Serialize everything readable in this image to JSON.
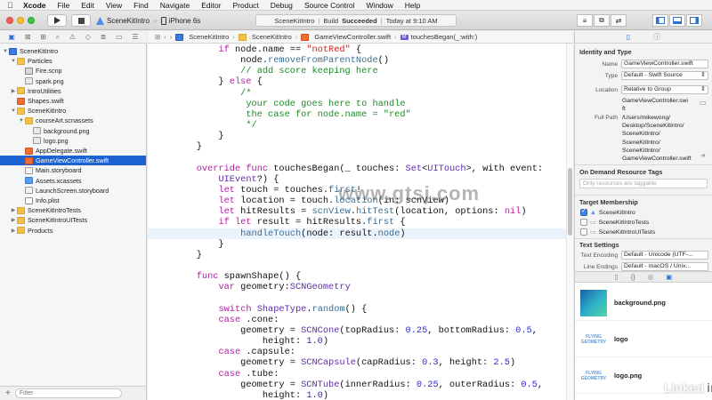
{
  "menubar": {
    "items": [
      "Xcode",
      "File",
      "Edit",
      "View",
      "Find",
      "Navigate",
      "Editor",
      "Product",
      "Debug",
      "Source Control",
      "Window",
      "Help"
    ]
  },
  "toolbar": {
    "scheme": "SceneKitIntro",
    "device": "iPhone 6s",
    "status_project": "SceneKitIntro",
    "status_build": "Build",
    "status_result": "Succeeded",
    "status_time": "Today at 9:10 AM"
  },
  "navigator": {
    "rows": [
      {
        "label": "SceneKitIntro",
        "icon": "project-icon",
        "indent": 0,
        "open": true
      },
      {
        "label": "Particles",
        "icon": "folder-icon",
        "indent": 1,
        "open": true
      },
      {
        "label": "Fire.scnp",
        "icon": "particle-file-icon",
        "indent": 2,
        "open": null
      },
      {
        "label": "spark.png",
        "icon": "image-file-icon",
        "indent": 2,
        "open": null
      },
      {
        "label": "IntroUtilities",
        "icon": "folder-icon",
        "indent": 1,
        "open": false
      },
      {
        "label": "Shapes.swift",
        "icon": "swift-file-icon",
        "indent": 1,
        "open": null
      },
      {
        "label": "SceneKitIntro",
        "icon": "folder-icon",
        "indent": 1,
        "open": true
      },
      {
        "label": "courseArt.scnassets",
        "icon": "folder-icon",
        "indent": 2,
        "open": true
      },
      {
        "label": "background.png",
        "icon": "image-file-icon",
        "indent": 3,
        "open": null
      },
      {
        "label": "logo.png",
        "icon": "image-file-icon",
        "indent": 3,
        "open": null
      },
      {
        "label": "AppDelegate.swift",
        "icon": "swift-file-icon",
        "indent": 2,
        "open": null
      },
      {
        "label": "GameViewController.swift",
        "icon": "swift-file-icon",
        "indent": 2,
        "open": null,
        "selected": true
      },
      {
        "label": "Main.storyboard",
        "icon": "storyboard-file-icon",
        "indent": 2,
        "open": null
      },
      {
        "label": "Assets.xcassets",
        "icon": "asset-catalog-icon",
        "indent": 2,
        "open": null
      },
      {
        "label": "LaunchScreen.storyboard",
        "icon": "storyboard-file-icon",
        "indent": 2,
        "open": null
      },
      {
        "label": "Info.plist",
        "icon": "plist-file-icon",
        "indent": 2,
        "open": null
      },
      {
        "label": "SceneKitIntroTests",
        "icon": "folder-icon",
        "indent": 1,
        "open": false
      },
      {
        "label": "SceneKitIntroUITests",
        "icon": "folder-icon",
        "indent": 1,
        "open": false
      },
      {
        "label": "Products",
        "icon": "folder-icon",
        "indent": 1,
        "open": false
      }
    ],
    "filter_placeholder": "Filter"
  },
  "jumpbar": {
    "crumbs": [
      "SceneKitIntro",
      "SceneKitIntro",
      "GameViewController.swift",
      "touchesBegan(_:with:)"
    ]
  },
  "editor": {
    "lines": [
      [
        {
          "t": "        "
        },
        {
          "t": "if",
          "c": "kw"
        },
        {
          "t": " node.name == "
        },
        {
          "t": "\"notRed\"",
          "c": "st"
        },
        {
          "t": " {"
        }
      ],
      [
        {
          "t": "            node."
        },
        {
          "t": "removeFromParentNode",
          "c": "fn"
        },
        {
          "t": "()"
        }
      ],
      [
        {
          "t": "            "
        },
        {
          "t": "// add score keeping here",
          "c": "cm"
        }
      ],
      [
        {
          "t": "        } "
        },
        {
          "t": "else",
          "c": "kw"
        },
        {
          "t": " {"
        }
      ],
      [
        {
          "t": "            "
        },
        {
          "t": "/*",
          "c": "cm"
        }
      ],
      [
        {
          "t": "             your code goes here to handle",
          "c": "cm"
        }
      ],
      [
        {
          "t": "             the case for node.name = \"red\"",
          "c": "cm"
        }
      ],
      [
        {
          "t": "             */",
          "c": "cm"
        }
      ],
      [
        {
          "t": "        }"
        }
      ],
      [
        {
          "t": "    }"
        }
      ],
      [
        {
          "t": ""
        }
      ],
      [
        {
          "t": "    "
        },
        {
          "t": "override",
          "c": "kw"
        },
        {
          "t": " "
        },
        {
          "t": "func",
          "c": "kw"
        },
        {
          "t": " touchesBegan(_ touches: "
        },
        {
          "t": "Set",
          "c": "ty"
        },
        {
          "t": "<"
        },
        {
          "t": "UITouch",
          "c": "ty"
        },
        {
          "t": ">, with event:"
        }
      ],
      [
        {
          "t": "        "
        },
        {
          "t": "UIEvent",
          "c": "ty"
        },
        {
          "t": "?) {"
        }
      ],
      [
        {
          "t": "        "
        },
        {
          "t": "let",
          "c": "kw"
        },
        {
          "t": " touch = touches."
        },
        {
          "t": "first",
          "c": "fn"
        },
        {
          "t": "!"
        }
      ],
      [
        {
          "t": "        "
        },
        {
          "t": "let",
          "c": "kw"
        },
        {
          "t": " location = touch."
        },
        {
          "t": "location",
          "c": "fn"
        },
        {
          "t": "(in: scnView)"
        }
      ],
      [
        {
          "t": "        "
        },
        {
          "t": "let",
          "c": "kw"
        },
        {
          "t": " hitResults = "
        },
        {
          "t": "scnView",
          "c": "fn"
        },
        {
          "t": "."
        },
        {
          "t": "hitTest",
          "c": "fn"
        },
        {
          "t": "(location, options: "
        },
        {
          "t": "nil",
          "c": "kw"
        },
        {
          "t": ")"
        }
      ],
      [
        {
          "t": "        "
        },
        {
          "t": "if",
          "c": "kw"
        },
        {
          "t": " "
        },
        {
          "t": "let",
          "c": "kw"
        },
        {
          "t": " result = hitResults."
        },
        {
          "t": "first",
          "c": "fn"
        },
        {
          "t": " {"
        }
      ],
      [
        {
          "t": "            "
        },
        {
          "t": "handleTouch",
          "c": "fn"
        },
        {
          "t": "(node: result."
        },
        {
          "t": "node",
          "c": "fn"
        },
        {
          "t": ")"
        }
      ],
      [
        {
          "t": "        }"
        }
      ],
      [
        {
          "t": "    }"
        }
      ],
      [
        {
          "t": ""
        }
      ],
      [
        {
          "t": "    "
        },
        {
          "t": "func",
          "c": "kw"
        },
        {
          "t": " spawnShape() {"
        }
      ],
      [
        {
          "t": "        "
        },
        {
          "t": "var",
          "c": "kw"
        },
        {
          "t": " geometry:"
        },
        {
          "t": "SCNGeometry",
          "c": "ty"
        }
      ],
      [
        {
          "t": ""
        }
      ],
      [
        {
          "t": "        "
        },
        {
          "t": "switch",
          "c": "kw"
        },
        {
          "t": " "
        },
        {
          "t": "ShapeType",
          "c": "ty"
        },
        {
          "t": "."
        },
        {
          "t": "random",
          "c": "fn"
        },
        {
          "t": "() {"
        }
      ],
      [
        {
          "t": "        "
        },
        {
          "t": "case",
          "c": "kw"
        },
        {
          "t": " .cone:"
        }
      ],
      [
        {
          "t": "            geometry = "
        },
        {
          "t": "SCNCone",
          "c": "ty"
        },
        {
          "t": "(topRadius: "
        },
        {
          "t": "0.25",
          "c": "nu"
        },
        {
          "t": ", bottomRadius: "
        },
        {
          "t": "0.5",
          "c": "nu"
        },
        {
          "t": ","
        }
      ],
      [
        {
          "t": "                height: "
        },
        {
          "t": "1.0",
          "c": "nu"
        },
        {
          "t": ")"
        }
      ],
      [
        {
          "t": "        "
        },
        {
          "t": "case",
          "c": "kw"
        },
        {
          "t": " .capsule:"
        }
      ],
      [
        {
          "t": "            geometry = "
        },
        {
          "t": "SCNCapsule",
          "c": "ty"
        },
        {
          "t": "(capRadius: "
        },
        {
          "t": "0.3",
          "c": "nu"
        },
        {
          "t": ", height: "
        },
        {
          "t": "2.5",
          "c": "nu"
        },
        {
          "t": ")"
        }
      ],
      [
        {
          "t": "        "
        },
        {
          "t": "case",
          "c": "kw"
        },
        {
          "t": " .tube:"
        }
      ],
      [
        {
          "t": "            geometry = "
        },
        {
          "t": "SCNTube",
          "c": "ty"
        },
        {
          "t": "(innerRadius: "
        },
        {
          "t": "0.25",
          "c": "nu"
        },
        {
          "t": ", outerRadius: "
        },
        {
          "t": "0.5",
          "c": "nu"
        },
        {
          "t": ","
        }
      ],
      [
        {
          "t": "                height: "
        },
        {
          "t": "1.0",
          "c": "nu"
        },
        {
          "t": ")"
        }
      ]
    ],
    "highlighted_line": 17
  },
  "watermark": "www.gtsj.com",
  "brand": {
    "text": "Linked",
    "in": "in"
  },
  "inspector": {
    "identity_title": "Identity and Type",
    "name_label": "Name",
    "name_value": "GameViewController.swift",
    "type_label": "Type",
    "type_value": "Default - Swift Source",
    "location_label": "Location",
    "location_value": "Relative to Group",
    "location_path": [
      "GameViewController.swi",
      "ft"
    ],
    "fullpath_label": "Full Path",
    "fullpath_lines": [
      "/Users/mikewong/",
      "Desktop/SceneKitIntro/",
      "SceneKitIntro/",
      "SceneKitIntro/",
      "SceneKitIntro/",
      "GameViewController.swift"
    ],
    "odr_title": "On Demand Resource Tags",
    "odr_placeholder": "Only resources are taggable",
    "target_title": "Target Membership",
    "targets": [
      {
        "label": "SceneKitIntro",
        "checked": true
      },
      {
        "label": "SceneKitIntroTests",
        "checked": false
      },
      {
        "label": "SceneKitIntroUITests",
        "checked": false
      }
    ],
    "text_settings_title": "Text Settings",
    "encoding_label": "Text Encoding",
    "encoding_value": "Default - Unicode (UTF-...",
    "line_endings_label": "Line Endings",
    "line_endings_value": "Default - macOS / Unix..."
  },
  "library": {
    "items": [
      {
        "name": "background.png",
        "thumb": "bg",
        "thumb_text": ""
      },
      {
        "name": "logo",
        "thumb": "logo",
        "thumb_text": "FLYING GEOMETRY"
      },
      {
        "name": "logo.png",
        "thumb": "logo",
        "thumb_text": "FLYING GEOMETRY"
      }
    ]
  }
}
